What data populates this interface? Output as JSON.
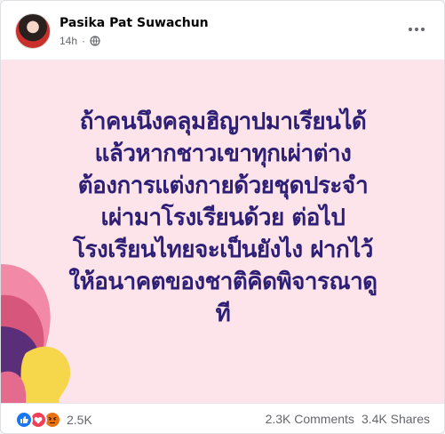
{
  "post": {
    "author": "Pasika Pat Suwachun",
    "time": "14h",
    "privacy_icon": "globe-icon",
    "menu_icon": "more-options-icon",
    "background_color": "#fde3ea",
    "text_color": "#2d1f75",
    "lines": [
      "ถ้าคนนึงคลุมฮิญาปมาเรียนได้",
      "แล้วหากชาวเขาทุกเผ่าต่าง",
      "ต้องการแต่งกายด้วยชุดประจำ",
      "เผ่ามาโรงเรียนด้วย ต่อไป",
      "โรงเรียนไทยจะเป็นยังไง ฝากไว้",
      "ให้อนาคตของชาติคิดพิจารณาดู",
      "ที"
    ]
  },
  "engagement": {
    "reaction_icons": [
      "like-icon",
      "love-icon",
      "angry-icon"
    ],
    "reactions_count": "2.5K",
    "comments": "2.3K Comments",
    "shares": "3.4K Shares"
  }
}
